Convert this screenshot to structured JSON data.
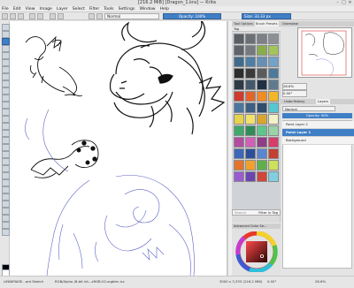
{
  "window": {
    "title": "[216.2 MiB]   [Dragon_1.kra] — Krita",
    "controls": [
      "–",
      "□",
      "✕"
    ]
  },
  "menu": [
    "File",
    "Edit",
    "View",
    "Image",
    "Layer",
    "Select",
    "Filter",
    "Tools",
    "Settings",
    "Window",
    "Help"
  ],
  "tool_options": {
    "blend_mode": "Normal",
    "opacity_label": "Opacity: 100%",
    "size_label": "Size: 33.33 px"
  },
  "brush_presets": {
    "tabs": [
      "Tool Options",
      "Brush Presets"
    ],
    "tag_label": "Tag",
    "search_placeholder": "Search",
    "filter_label": "Filter in Tag",
    "swatch_colors": [
      "#5a5f66",
      "#6b7077",
      "#7c8188",
      "#8c9096",
      "#5f646b",
      "#767a80",
      "#89ad4b",
      "#a2c45a",
      "#3f6b8e",
      "#4e7ea6",
      "#668fb5",
      "#73a3c8",
      "#2d2d2d",
      "#3a3a3a",
      "#5b5b5b",
      "#4d7a9c",
      "#2e3a46",
      "#44596c",
      "#1f3043",
      "#61798f",
      "#cf3b2d",
      "#e4632a",
      "#f08b25",
      "#f2b62b",
      "#4a77a0",
      "#3c5f82",
      "#2f4d6c",
      "#56c6d0",
      "#e6d24b",
      "#f0e26b",
      "#d9a62d",
      "#f3f1c6",
      "#3fa86b",
      "#2f8c57",
      "#5fc68a",
      "#9ad3a8",
      "#b34b9f",
      "#d15fb8",
      "#8e3d86",
      "#d63d6a",
      "#3a67b7",
      "#2d4f99",
      "#5a86d1",
      "#c24130",
      "#e4742a",
      "#f1a12c",
      "#5fb04d",
      "#cfe05a",
      "#9a5bd1",
      "#6b44b0",
      "#d0463b",
      "#7fcfe0"
    ]
  },
  "color_selector": {
    "header": "Advanced Color Se...",
    "current_color": "#7a1212"
  },
  "overview": {
    "header": "Overview",
    "zoom": "28.6%",
    "rotation": "0.00°"
  },
  "layers": {
    "tabs": [
      "Undo History",
      "Layers"
    ],
    "blend_mode": "Normal",
    "opacity": "Opacity: 90%",
    "items": [
      {
        "name": "Paint Layer 2",
        "selected": false
      },
      {
        "name": "Paint Layer 1",
        "selected": true
      },
      {
        "name": "Background",
        "selected": false
      }
    ]
  },
  "status": {
    "brush": "LINNERASE...ard Sketch",
    "color_model": "RGB/Alpha (8-bit int...sRGB-V2-srgbtrc.icc",
    "dimensions": "3000 x 3,333 (216.2 MiB)",
    "rotation": "0.00°",
    "zoom": "28.6%"
  }
}
